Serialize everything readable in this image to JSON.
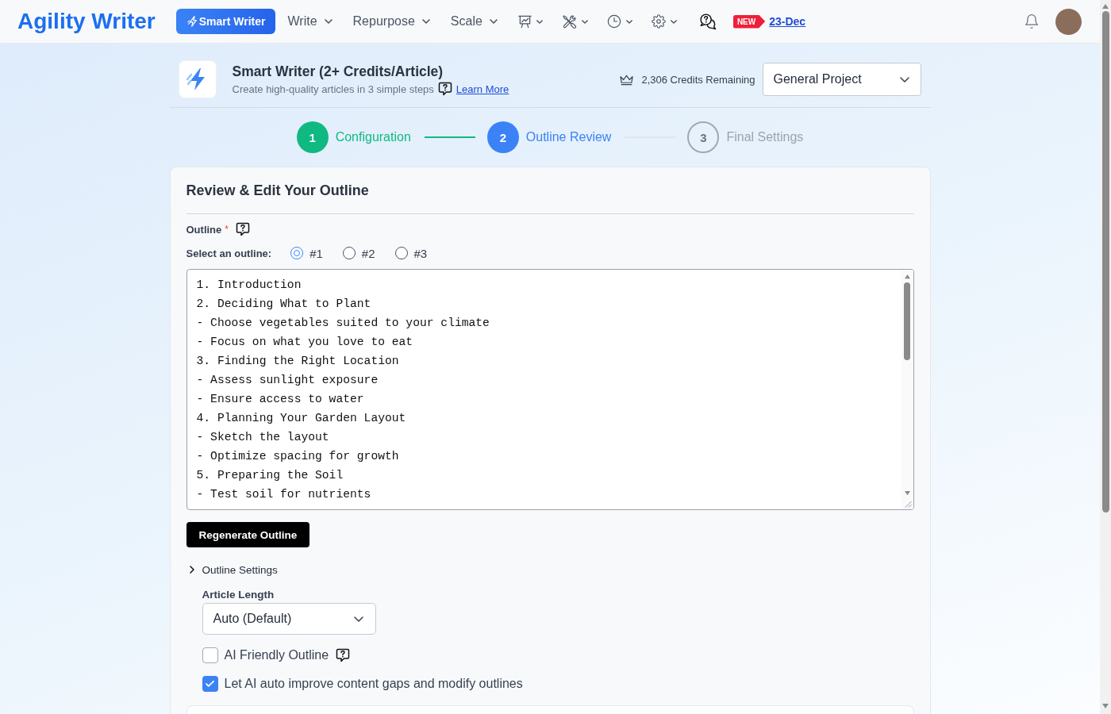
{
  "nav": {
    "logo": "Agility Writer",
    "primary_button": "Smart Writer",
    "menus": [
      "Write",
      "Repurpose",
      "Scale"
    ],
    "new_badge": "NEW",
    "release_link": "23-Dec"
  },
  "header": {
    "title": "Smart Writer (2+ Credits/Article)",
    "subtitle": "Create high-quality articles in 3 simple steps",
    "link": "Learn More",
    "credits": "2,306 Credits Remaining",
    "project": "General Project"
  },
  "steps": [
    {
      "number": "1",
      "label": "Configuration",
      "completed": true,
      "selected": false
    },
    {
      "number": "2",
      "label": "Outline Review",
      "completed": false,
      "selected": true
    },
    {
      "number": "3",
      "label": "Final Settings",
      "completed": false,
      "selected": false
    }
  ],
  "card": {
    "title": "Review & Edit Your Outline",
    "outline_label": "Outline",
    "required_mark": "*",
    "select_label": "Select an outline:",
    "options": [
      {
        "label": "#1",
        "selected": true
      },
      {
        "label": "#2",
        "selected": false
      },
      {
        "label": "#3",
        "selected": false
      }
    ],
    "outline_text": "1. Introduction\n2. Deciding What to Plant\n- Choose vegetables suited to your climate\n- Focus on what you love to eat\n3. Finding the Right Location\n- Assess sunlight exposure\n- Ensure access to water\n4. Planning Your Garden Layout\n- Sketch the layout\n- Optimize spacing for growth\n5. Preparing the Soil\n- Test soil for nutrients",
    "regenerate_button": "Regenerate Outline",
    "settings": {
      "label": "Outline Settings",
      "expanded": false,
      "length_label": "Article Length",
      "length_value": "Auto (Default)",
      "checkboxes": [
        {
          "label": "AI Friendly Outline",
          "checked": false,
          "help": true
        },
        {
          "label": "Let AI auto improve content gaps and modify outlines",
          "checked": true,
          "help": false
        }
      ]
    }
  }
}
